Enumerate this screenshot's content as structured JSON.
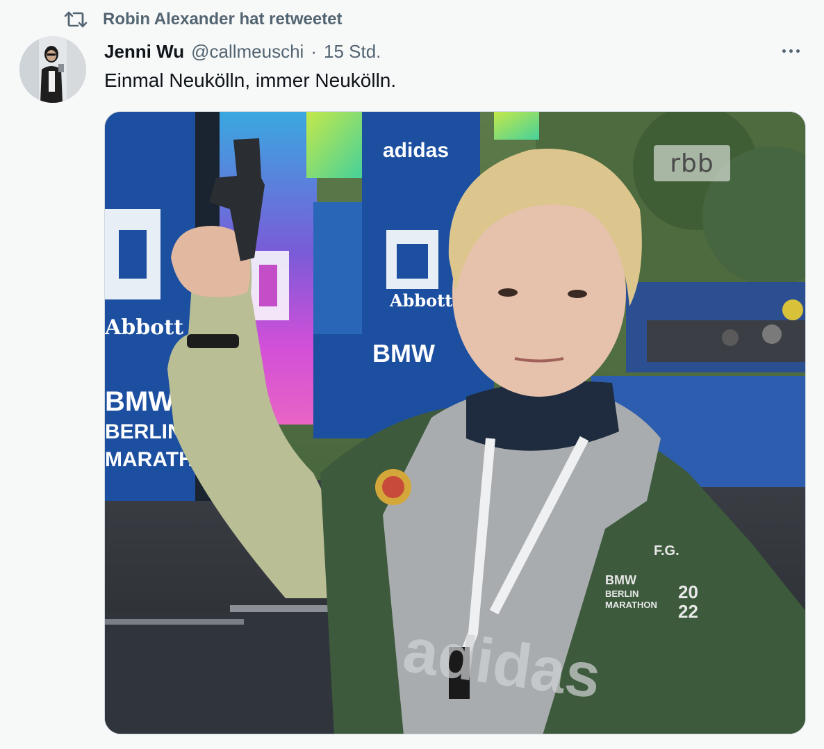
{
  "retweet": {
    "icon": "retweet-icon",
    "text": "Robin Alexander hat retweetet"
  },
  "author": {
    "display_name": "Jenni Wu",
    "handle": "@callmeuschi",
    "separator": "·",
    "time": "15 Std."
  },
  "tweet": {
    "text": "Einmal Neukölln, immer Neukölln."
  },
  "media": {
    "watermark": "rbb",
    "jacket_initials": "F.G.",
    "jacket_logo_line1": "BMW",
    "jacket_logo_line2": "BERLIN",
    "jacket_logo_line3": "MARATHON",
    "jacket_year_top": "20",
    "jacket_year_bottom": "22",
    "banner_abbott": "Abbott",
    "banner_adidas": "adidas",
    "banner_bmw": "BMW",
    "banner_berlin": "BERLIN",
    "banner_marathon": "MARATHON",
    "shirt_text": "adidas"
  },
  "colors": {
    "background": "#f7f9f9",
    "secondary_text": "#536471",
    "primary_text": "#0f1419",
    "banner_blue": "#1d4fa0",
    "jacket_green": "#3d5a3c"
  }
}
